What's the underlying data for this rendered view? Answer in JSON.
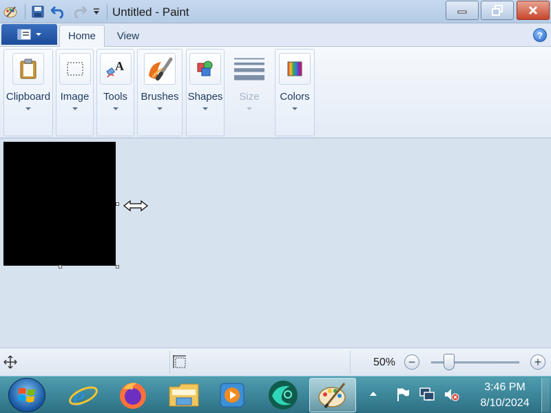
{
  "window": {
    "title": "Untitled - Paint"
  },
  "quick_access": {
    "save_icon": "save-icon",
    "undo_icon": "undo-icon",
    "redo_icon": "redo-icon",
    "customize_icon": "chevron-down-icon"
  },
  "tabs": [
    {
      "label": "Home",
      "active": true
    },
    {
      "label": "View",
      "active": false
    }
  ],
  "help_label": "?",
  "ribbon": {
    "groups": [
      {
        "label": "Clipboard",
        "icon": "clipboard-icon",
        "enabled": true
      },
      {
        "label": "Image",
        "icon": "select-rectangle-icon",
        "enabled": true
      },
      {
        "label": "Tools",
        "icon": "tools-icon",
        "enabled": true
      },
      {
        "label": "Brushes",
        "icon": "brush-icon",
        "enabled": true
      },
      {
        "label": "Shapes",
        "icon": "shapes-icon",
        "enabled": true
      },
      {
        "label": "Size",
        "icon": "line-size-icon",
        "enabled": false
      },
      {
        "label": "Colors",
        "icon": "color-palette-icon",
        "enabled": true
      }
    ]
  },
  "canvas": {
    "fill_color": "#000000"
  },
  "statusbar": {
    "zoom": "50%",
    "zoom_out_label": "−",
    "zoom_in_label": "+",
    "zoom_fraction": 0.2
  },
  "taskbar": {
    "items": [
      "internet-explorer-icon",
      "firefox-icon",
      "file-explorer-icon",
      "media-player-icon",
      "cyberlink-icon",
      "paint-icon"
    ],
    "active": "paint-icon",
    "tray": [
      "flag-icon",
      "network-icon",
      "volume-muted-icon"
    ],
    "time": "3:46 PM",
    "date": "8/10/2024"
  },
  "colors": {
    "accent": "#1c4b99",
    "taskbar": "#2c6f83",
    "close": "#c8452a"
  }
}
